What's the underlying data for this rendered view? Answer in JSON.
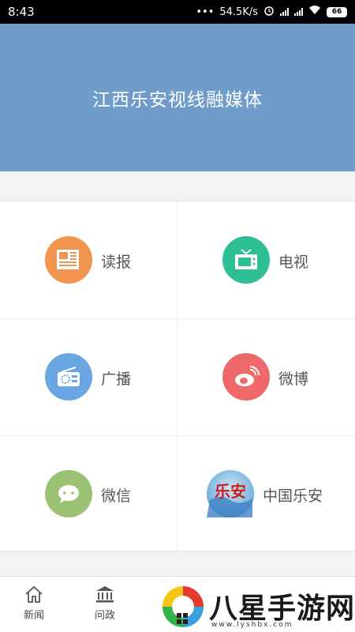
{
  "status_bar": {
    "time": "8:43",
    "network_speed": "54.5K/s",
    "battery": "66"
  },
  "header": {
    "title": "江西乐安视线融媒体"
  },
  "grid": {
    "items": [
      {
        "label": "读报",
        "icon": "newspaper-icon",
        "color": "#f0944f"
      },
      {
        "label": "电视",
        "icon": "tv-icon",
        "color": "#2fbf96"
      },
      {
        "label": "广播",
        "icon": "radio-icon",
        "color": "#6aa6e2"
      },
      {
        "label": "微博",
        "icon": "weibo-icon",
        "color": "#ee6a6a"
      },
      {
        "label": "微信",
        "icon": "wechat-icon",
        "color": "#9ac272"
      },
      {
        "label": "中国乐安",
        "icon": "lean-logo-icon",
        "color": "#2f6fb0"
      }
    ]
  },
  "tab_bar": {
    "tabs": [
      {
        "label": "新闻",
        "icon": "home-icon"
      },
      {
        "label": "问政",
        "icon": "government-icon"
      }
    ]
  },
  "watermark": {
    "text": "八星手游网",
    "url": "www.lyshbx.com",
    "logo_text": "乐安"
  }
}
